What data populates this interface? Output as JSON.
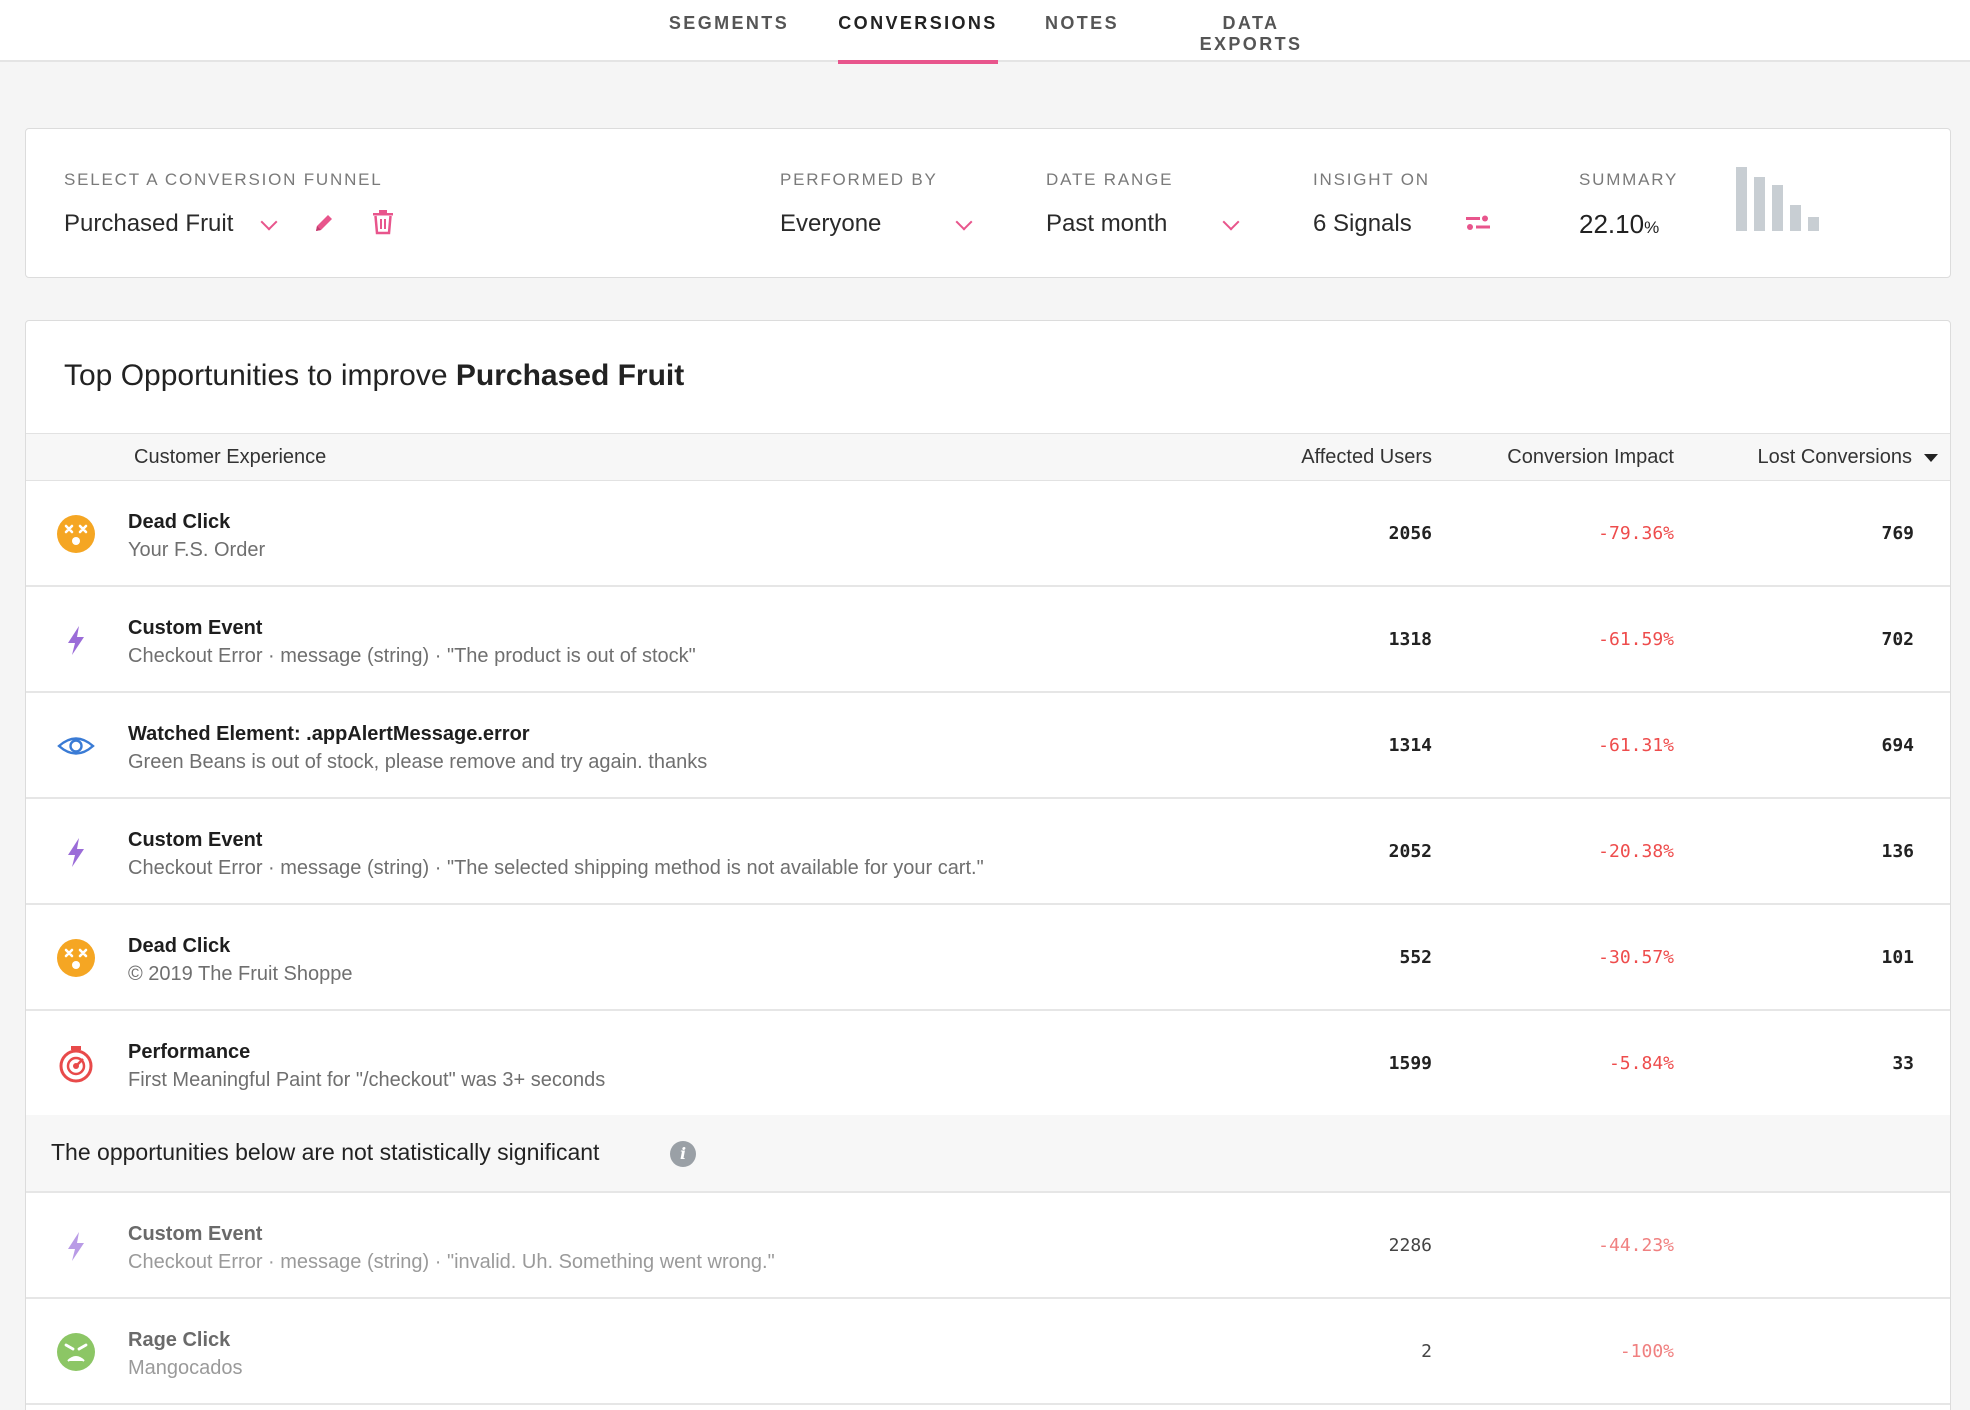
{
  "nav": {
    "tabs": [
      {
        "label": "SEGMENTS"
      },
      {
        "label": "CONVERSIONS"
      },
      {
        "label": "NOTES"
      },
      {
        "label": "DATA EXPORTS"
      }
    ],
    "active": "CONVERSIONS",
    "accent_color": "#e8558c"
  },
  "filters": {
    "funnel_label": "SELECT A CONVERSION FUNNEL",
    "funnel_value": "Purchased Fruit",
    "performed_by_label": "PERFORMED BY",
    "performed_by_value": "Everyone",
    "date_range_label": "DATE RANGE",
    "date_range_value": "Past month",
    "insight_label": "INSIGHT ON",
    "insight_value": "6 Signals",
    "summary_label": "SUMMARY",
    "summary_value": "22.10",
    "summary_unit": "%"
  },
  "opportunities": {
    "title_prefix": "Top Opportunities to improve ",
    "title_funnel": "Purchased Fruit",
    "columns": {
      "experience": "Customer Experience",
      "affected": "Affected Users",
      "impact": "Conversion Impact",
      "lost": "Lost Conversions"
    },
    "rows": [
      {
        "icon": "dead-click-icon",
        "title": "Dead Click",
        "subtitle": "Your F.S. Order",
        "affected": "2056",
        "impact": "-79.36%",
        "lost": "769"
      },
      {
        "icon": "custom-event-icon",
        "title": "Custom Event",
        "subtitle": "Checkout Error · message (string) · \"The product is out of stock\"",
        "affected": "1318",
        "impact": "-61.59%",
        "lost": "702"
      },
      {
        "icon": "watched-element-icon",
        "title": "Watched Element: .appAlertMessage.error",
        "subtitle": "Green Beans is out of stock, please remove and try again. thanks",
        "affected": "1314",
        "impact": "-61.31%",
        "lost": "694"
      },
      {
        "icon": "custom-event-icon",
        "title": "Custom Event",
        "subtitle": "Checkout Error · message (string) · \"The selected shipping method is not available for your cart.\"",
        "affected": "2052",
        "impact": "-20.38%",
        "lost": "136"
      },
      {
        "icon": "dead-click-icon",
        "title": "Dead Click",
        "subtitle": "© 2019 The Fruit Shoppe",
        "affected": "552",
        "impact": "-30.57%",
        "lost": "101"
      },
      {
        "icon": "performance-icon",
        "title": "Performance",
        "subtitle": "First Meaningful Paint for \"/checkout\" was 3+ seconds",
        "affected": "1599",
        "impact": "-5.84%",
        "lost": "33"
      }
    ],
    "not_significant_label": "The opportunities below are not statistically significant",
    "not_significant_rows": [
      {
        "icon": "custom-event-icon",
        "title": "Custom Event",
        "subtitle": "Checkout Error · message (string) · \"invalid. Uh. Something went wrong.\"",
        "affected": "2286",
        "impact": "-44.23%",
        "lost": ""
      },
      {
        "icon": "rage-click-icon",
        "title": "Rage Click",
        "subtitle": "Mangocados",
        "affected": "2",
        "impact": "-100%",
        "lost": ""
      }
    ]
  }
}
